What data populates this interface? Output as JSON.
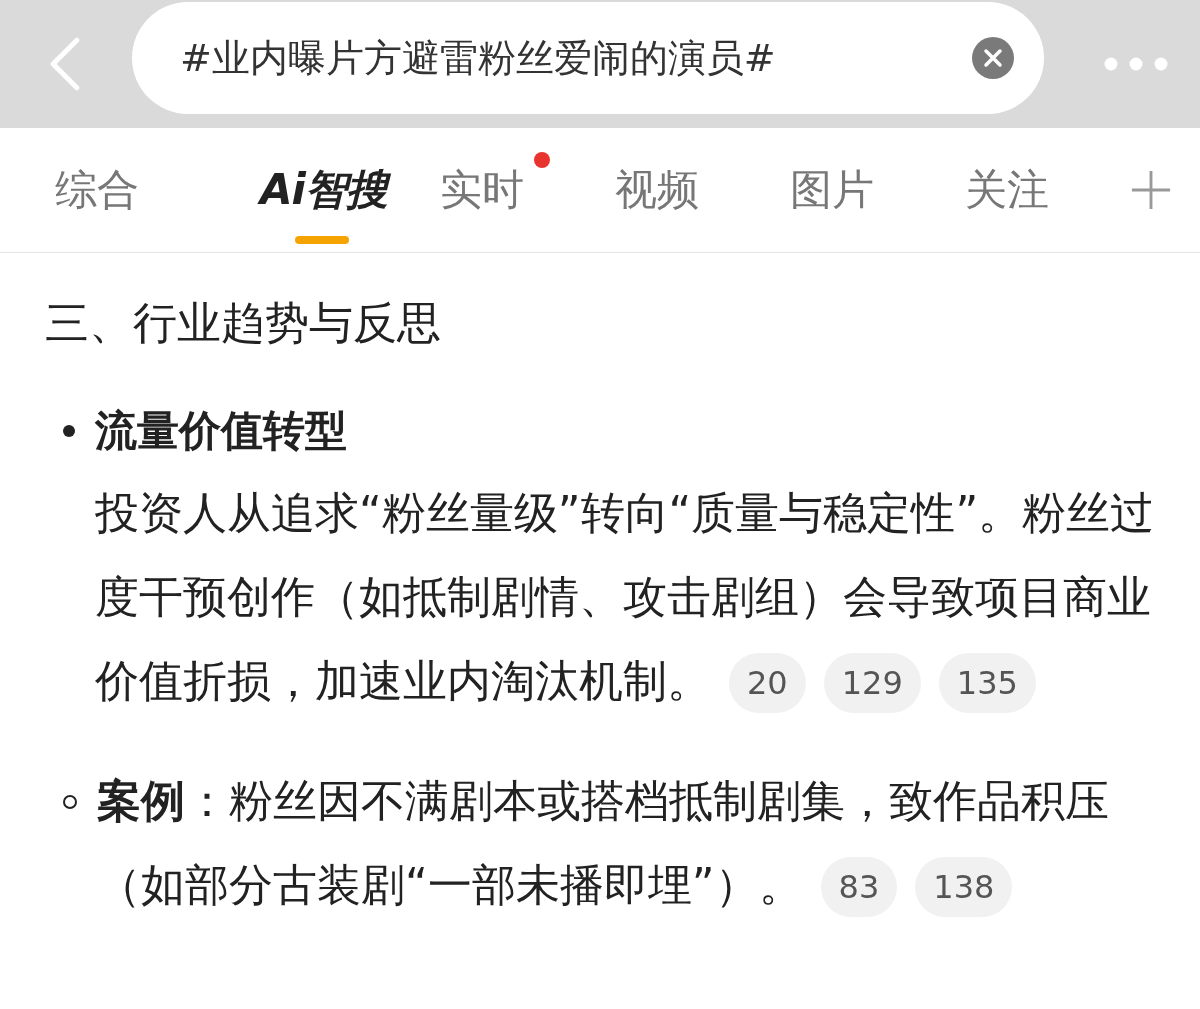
{
  "search": {
    "value": "#业内曝片方避雷粉丝爱闹的演员#"
  },
  "tabs": [
    {
      "label": "综合",
      "kind": "text",
      "selected": false,
      "badge": false
    },
    {
      "label": "Ai智搜",
      "kind": "logo",
      "selected": true,
      "badge": false
    },
    {
      "label": "实时",
      "kind": "text",
      "selected": false,
      "badge": true
    },
    {
      "label": "视频",
      "kind": "text",
      "selected": false,
      "badge": false
    },
    {
      "label": "图片",
      "kind": "text",
      "selected": false,
      "badge": false
    },
    {
      "label": "关注",
      "kind": "text",
      "selected": false,
      "badge": false
    }
  ],
  "heading": "三、行业趋势与反思",
  "items": [
    {
      "kind": "bullet",
      "title": "流量价值转型",
      "text": "投资人从追求“粉丝量级”转向“质量与稳定性”。粉丝过度干预创作（如抵制剧情、攻击剧组）会导致项目商业价值折损，加速业内淘汰机制。",
      "refs": [
        "20",
        "129",
        "135"
      ]
    },
    {
      "kind": "sub_bullet",
      "text": "**案例**：粉丝因不满剧本或搭档抵制剧集，致作品积压（如部分古装剧“一部未播即埋”）。",
      "refs": [
        "83",
        "138"
      ]
    }
  ]
}
